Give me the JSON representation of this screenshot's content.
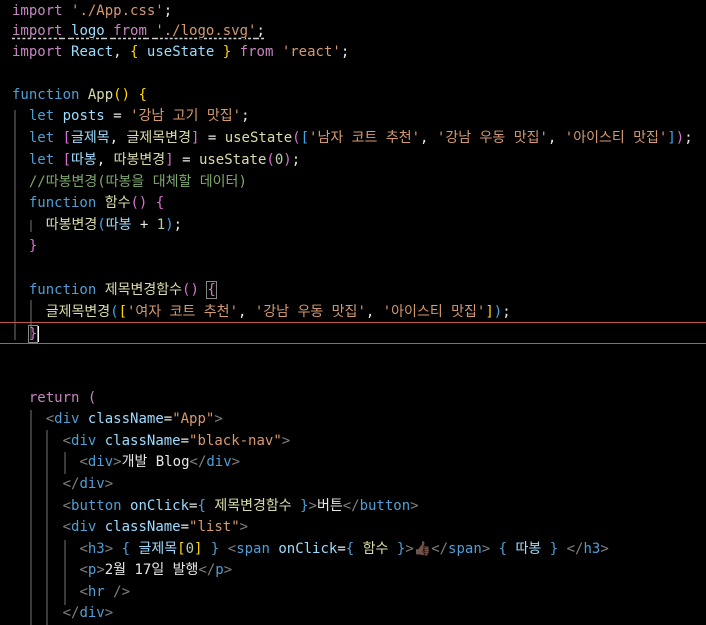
{
  "code": {
    "l1": {
      "kw": "import",
      "src": "'./App.css'",
      "semi": ";"
    },
    "l2": {
      "kw": "import",
      "name": "logo",
      "from": "from",
      "src": "'./logo.svg'",
      "semi": ";"
    },
    "l3": {
      "kw": "import",
      "name": "React",
      "comma": ",",
      "open": "{",
      "hook": "useState",
      "close": "}",
      "from": "from",
      "src": "'react'",
      "semi": ";"
    },
    "l5": {
      "kw": "function",
      "name": "App",
      "paren": "()",
      "brace": "{"
    },
    "l6": {
      "kw": "let",
      "var": "posts",
      "eq": "=",
      "val": "'강남 고기 맛집'",
      "semi": ";"
    },
    "l7": {
      "kw": "let",
      "lb": "[",
      "a": "글제목",
      "comma": ",",
      "b": "글제목변경",
      "rb": "]",
      "eq": "=",
      "fn": "useState",
      "lp": "(",
      "lsq": "[",
      "s1": "'남자 코트 추천'",
      "c1": ",",
      "s2": "'강남 우동 맛집'",
      "c2": ",",
      "s3": "'아이스티 맛집'",
      "rsq": "]",
      "rp": ")",
      "semi": ";"
    },
    "l8": {
      "kw": "let",
      "lb": "[",
      "a": "따봉",
      "comma": ",",
      "b": "따봉변경",
      "rb": "]",
      "eq": "=",
      "fn": "useState",
      "lp": "(",
      "num": "0",
      "rp": ")",
      "semi": ";"
    },
    "l9": {
      "comment": "//따봉변경(따봉을 대체할 데이터)"
    },
    "l10": {
      "kw": "function",
      "name": "함수",
      "paren": "()",
      "brace": "{"
    },
    "l11": {
      "fn": "따봉변경",
      "lp": "(",
      "arg": "따봉",
      "op": "+",
      "num": "1",
      "rp": ")",
      "semi": ";"
    },
    "l12": {
      "brace": "}"
    },
    "l14": {
      "kw": "function",
      "name": "제목변경함수",
      "paren": "()",
      "brace": "{"
    },
    "l15": {
      "fn": "글제목변경",
      "lp": "(",
      "lsq": "[",
      "s1": "'여자 코트 추천'",
      "c1": ",",
      "s2": "'강남 우동 맛집'",
      "c2": ",",
      "s3": "'아이스티 맛집'",
      "rsq": "]",
      "rp": ")",
      "semi": ";"
    },
    "l16": {
      "brace": "}"
    },
    "l19": {
      "kw": "return",
      "paren": "("
    },
    "l20": {
      "lt": "<",
      "tag": "div",
      "attr": "className",
      "eq": "=",
      "val": "\"App\"",
      "gt": ">"
    },
    "l21": {
      "lt": "<",
      "tag": "div",
      "attr": "className",
      "eq": "=",
      "val": "\"black-nav\"",
      "gt": ">"
    },
    "l22": {
      "lt": "<",
      "tag": "div",
      "gt": ">",
      "text": "개발 Blog",
      "clt": "</",
      "ctag": "div",
      "cgt": ">"
    },
    "l23": {
      "clt": "</",
      "ctag": "div",
      "cgt": ">"
    },
    "l24": {
      "lt": "<",
      "tag": "button",
      "attr": "onClick",
      "eq": "=",
      "ob": "{",
      "expr": "제목변경함수",
      "cb": "}",
      "gt": ">",
      "text": "버튼",
      "clt": "</",
      "ctag": "button",
      "cgt": ">"
    },
    "l25": {
      "lt": "<",
      "tag": "div",
      "attr": "className",
      "eq": "=",
      "val": "\"list\"",
      "gt": ">"
    },
    "l26": {
      "lt": "<",
      "tag": "h3",
      "gt": ">",
      "ob1": "{",
      "expr1": "글제목",
      "lsq": "[",
      "idx": "0",
      "rsq": "]",
      "cb1": "}",
      "lt2": "<",
      "tag2": "span",
      "attr": "onClick",
      "eq": "=",
      "ob2": "{",
      "expr2": "함수",
      "cb2": "}",
      "gt2": ">",
      "emoji": "👍🏿",
      "clt2": "</",
      "ctag2": "span",
      "cgt2": ">",
      "ob3": "{",
      "expr3": "따봉",
      "cb3": "}",
      "clt": "</",
      "ctag": "h3",
      "cgt": ">"
    },
    "l27": {
      "lt": "<",
      "tag": "p",
      "gt": ">",
      "text": "2월 17일 발행",
      "clt": "</",
      "ctag": "p",
      "cgt": ">"
    },
    "l28": {
      "lt": "<",
      "tag": "hr",
      "close": "/>"
    },
    "l29": {
      "clt": "</",
      "ctag": "div",
      "cgt": ">"
    }
  }
}
